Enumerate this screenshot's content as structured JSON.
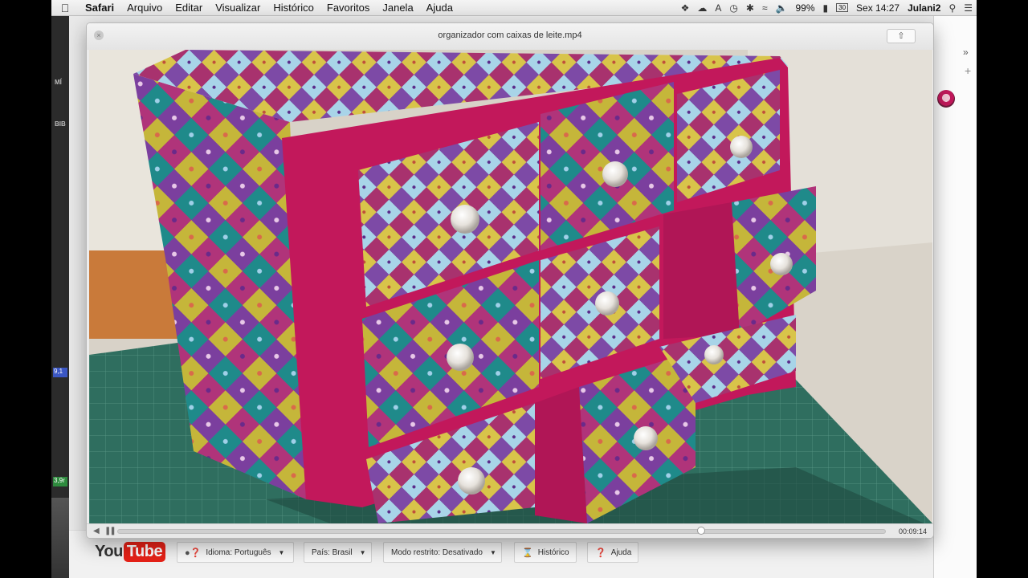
{
  "menubar": {
    "app": "Safari",
    "items": [
      "Arquivo",
      "Editar",
      "Visualizar",
      "Histórico",
      "Favoritos",
      "Janela",
      "Ajuda"
    ],
    "battery": "99%",
    "calendar_day": "30",
    "clock": "Sex 14:27",
    "user": "Julani2",
    "font_label": "A"
  },
  "background_app": {
    "labels": [
      "MÍ",
      "BIB"
    ],
    "tag_blue": "9,1",
    "tag_green": "3,9r"
  },
  "quicktime": {
    "title": "organizador com caixas de leite.mp4",
    "time": "00:09:14",
    "progress": 0.76
  },
  "youtube_footer": {
    "logo_you": "You",
    "logo_tube": "Tube",
    "language_button": "Idioma: Português",
    "country_button": "País: Brasil",
    "restricted_button": "Modo restrito: Desativado",
    "history_button": "Histórico",
    "help_button": "Ajuda"
  },
  "colors": {
    "fabric_magenta": "#c2185b",
    "fabric_purple": "#7b3f9e",
    "youtube_red": "#e62117",
    "cutting_mat": "#2f6e5f"
  }
}
